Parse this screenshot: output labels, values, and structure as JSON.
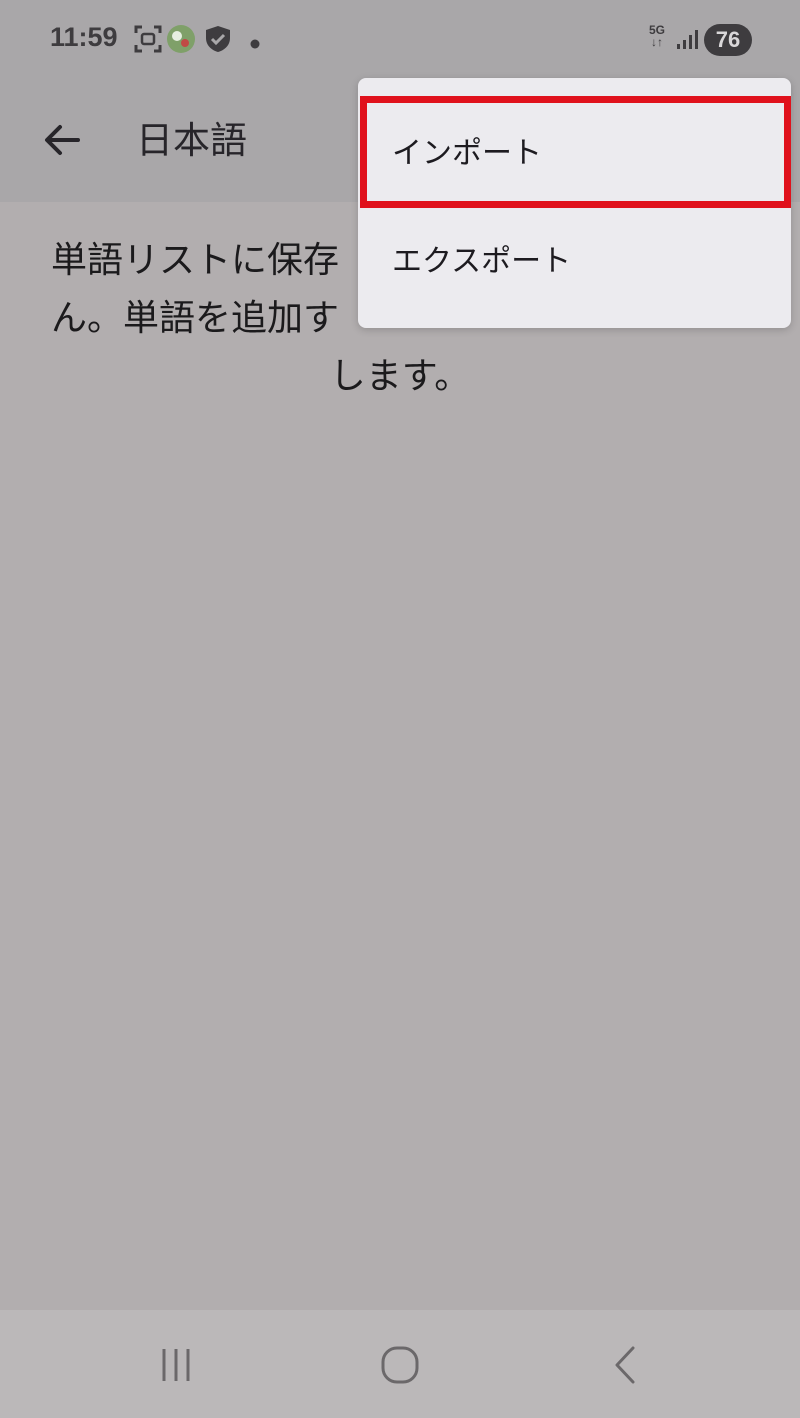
{
  "status_bar": {
    "time": "11:59",
    "network": "5G",
    "battery": "76",
    "icons": [
      "screenshot-icon",
      "app-notification-icon",
      "shield-check-icon",
      "dot-icon",
      "signal-icon"
    ]
  },
  "app_bar": {
    "title": "日本語",
    "back_icon": "arrow-back-icon"
  },
  "main": {
    "empty_message_line1": "単語リストに保存",
    "empty_message_line2": "ん。単語を追加す",
    "empty_message_line3": "します。"
  },
  "menu": {
    "items": [
      {
        "label": "インポート",
        "highlighted": true
      },
      {
        "label": "エクスポート",
        "highlighted": false
      }
    ],
    "highlight_color": "#e0111c"
  },
  "nav_bar": {
    "icons": [
      "recents-icon",
      "home-icon",
      "back-icon"
    ]
  }
}
